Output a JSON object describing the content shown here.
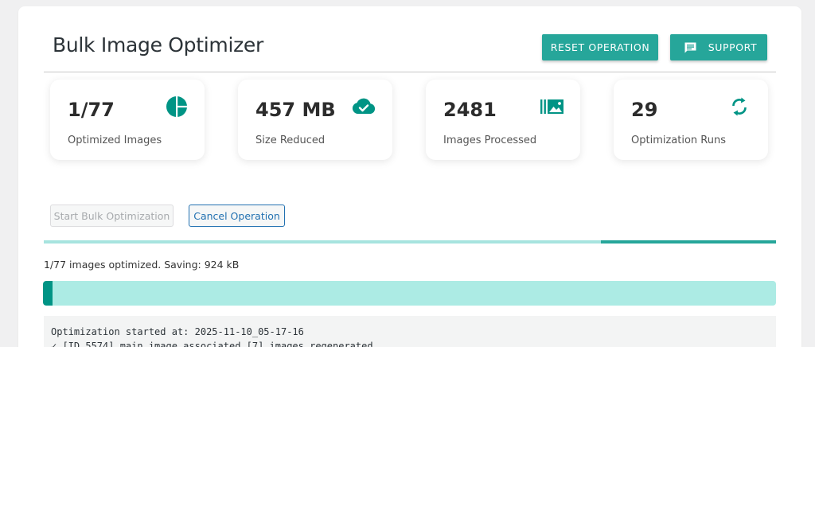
{
  "page": {
    "title": "Bulk Image Optimizer"
  },
  "header": {
    "reset_label": "RESET OPERATION",
    "support_label": "SUPPORT",
    "support_icon": "chat-icon"
  },
  "stats": [
    {
      "value": "1/77",
      "label": "Optimized Images",
      "icon": "pie-chart-icon"
    },
    {
      "value": "457 MB",
      "label": "Size Reduced",
      "icon": "cloud-check-icon"
    },
    {
      "value": "2481",
      "label": "Images Processed",
      "icon": "image-library-icon"
    },
    {
      "value": "29",
      "label": "Optimization Runs",
      "icon": "sync-icon"
    }
  ],
  "actions": {
    "start_label": "Start Bulk Optimization",
    "cancel_label": "Cancel Operation"
  },
  "progress": {
    "status_text": "1/77 images optimized. Saving: 924 kB",
    "fraction": 0.0129,
    "step_fraction": 0.239
  },
  "log": {
    "lines": [
      "Optimization started at: 2025-11-10_05-17-16",
      "✓ [ID 5574] main image associated [7] images regenerated"
    ]
  },
  "colors": {
    "accent": "#26a69a",
    "progress_fill": "#009485",
    "progress_track": "#acebe4",
    "link": "#2271b1"
  }
}
